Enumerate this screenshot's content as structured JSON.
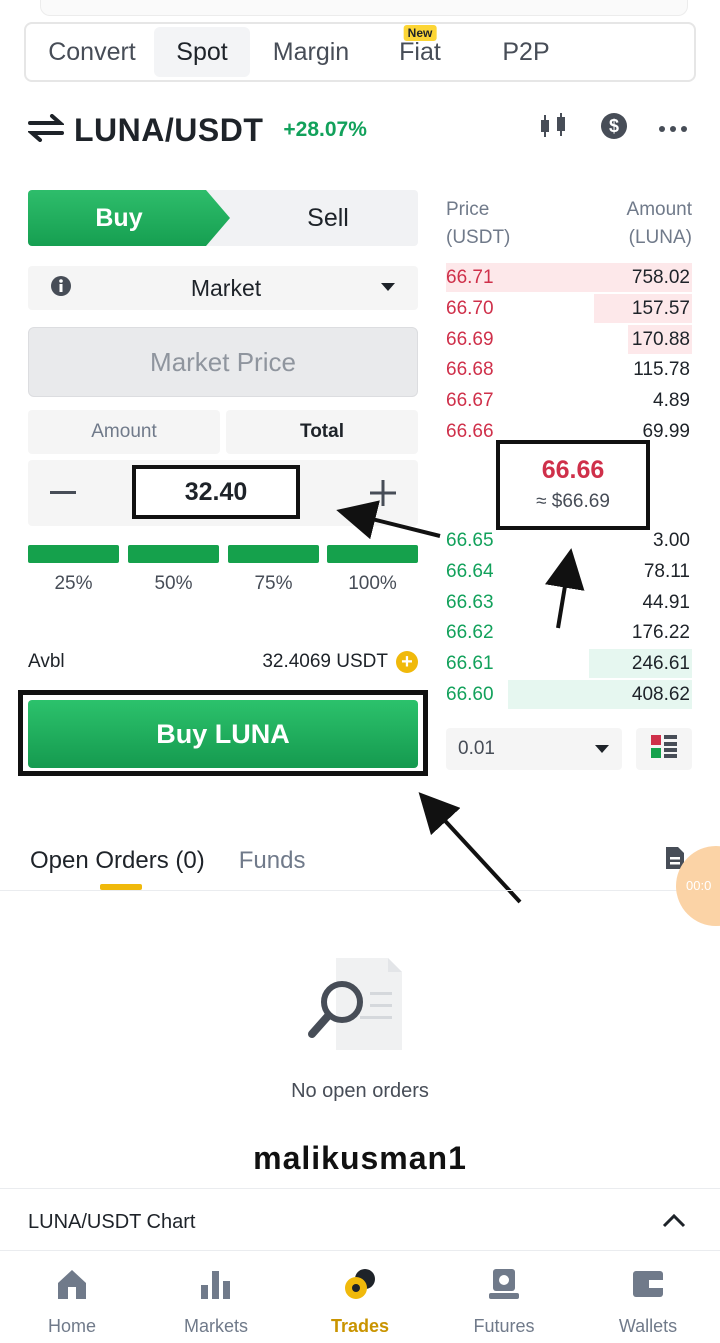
{
  "tabs": [
    {
      "label": "Convert"
    },
    {
      "label": "Spot"
    },
    {
      "label": "Margin"
    },
    {
      "label": "Fiat",
      "badge": "New"
    },
    {
      "label": "P2P"
    }
  ],
  "header": {
    "pair": "LUNA/USDT",
    "change": "+28.07%"
  },
  "trade": {
    "buy_label": "Buy",
    "sell_label": "Sell",
    "order_type": "Market",
    "price_placeholder": "Market Price",
    "amount_tab": "Amount",
    "total_tab": "Total",
    "stepper_value": "32.40",
    "percent_labels": [
      "25%",
      "50%",
      "75%",
      "100%"
    ],
    "avbl_label": "Avbl",
    "avbl_value": "32.4069 USDT",
    "buy_button": "Buy LUNA"
  },
  "orderbook": {
    "price_header": "Price",
    "price_unit": "(USDT)",
    "amount_header": "Amount",
    "amount_unit": "(LUNA)",
    "asks": [
      {
        "price": "66.71",
        "amount": "758.02",
        "depth": 1.0
      },
      {
        "price": "66.70",
        "amount": "157.57",
        "depth": 0.4
      },
      {
        "price": "66.69",
        "amount": "170.88",
        "depth": 0.26
      },
      {
        "price": "66.68",
        "amount": "115.78",
        "depth": 0.0
      },
      {
        "price": "66.67",
        "amount": "4.89",
        "depth": 0.0
      },
      {
        "price": "66.66",
        "amount": "69.99",
        "depth": 0.0
      }
    ],
    "mid_price": "66.66",
    "mid_usd": "≈ $66.69",
    "bids": [
      {
        "price": "66.65",
        "amount": "3.00",
        "depth": 0.0
      },
      {
        "price": "66.64",
        "amount": "78.11",
        "depth": 0.0
      },
      {
        "price": "66.63",
        "amount": "44.91",
        "depth": 0.0
      },
      {
        "price": "66.62",
        "amount": "176.22",
        "depth": 0.0
      },
      {
        "price": "66.61",
        "amount": "246.61",
        "depth": 0.42
      },
      {
        "price": "66.60",
        "amount": "408.62",
        "depth": 0.75
      }
    ],
    "precision": "0.01"
  },
  "orders": {
    "open_tab": "Open Orders (0)",
    "funds_tab": "Funds",
    "timer": "00:0",
    "empty_text": "No open orders"
  },
  "watermark": "malikusman1",
  "chart_row": {
    "label": "LUNA/USDT Chart"
  },
  "nav": [
    {
      "label": "Home",
      "icon": "home-icon"
    },
    {
      "label": "Markets",
      "icon": "markets-icon"
    },
    {
      "label": "Trades",
      "icon": "trades-icon"
    },
    {
      "label": "Futures",
      "icon": "futures-icon"
    },
    {
      "label": "Wallets",
      "icon": "wallets-icon"
    }
  ],
  "colors": {
    "buy": "#15a14c",
    "sell": "#cf304a",
    "accent": "#f0b90b"
  }
}
